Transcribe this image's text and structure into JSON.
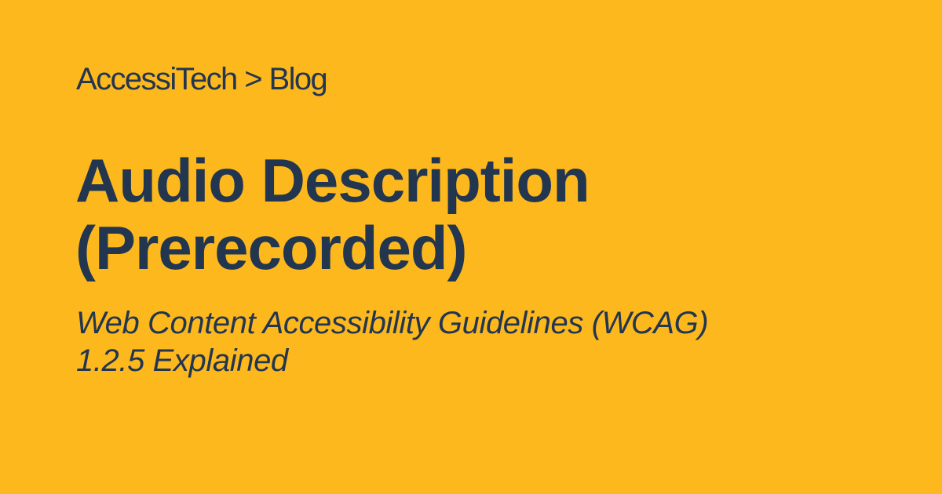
{
  "breadcrumb": {
    "text": "AccessiTech > Blog"
  },
  "title": {
    "line1": "Audio Description",
    "line2": "(Prerecorded)"
  },
  "subtitle": {
    "line1": "Web Content Accessibility Guidelines (WCAG)",
    "line2": "1.2.5 Explained"
  },
  "colors": {
    "background": "#FDB81E",
    "text": "#23364F"
  }
}
